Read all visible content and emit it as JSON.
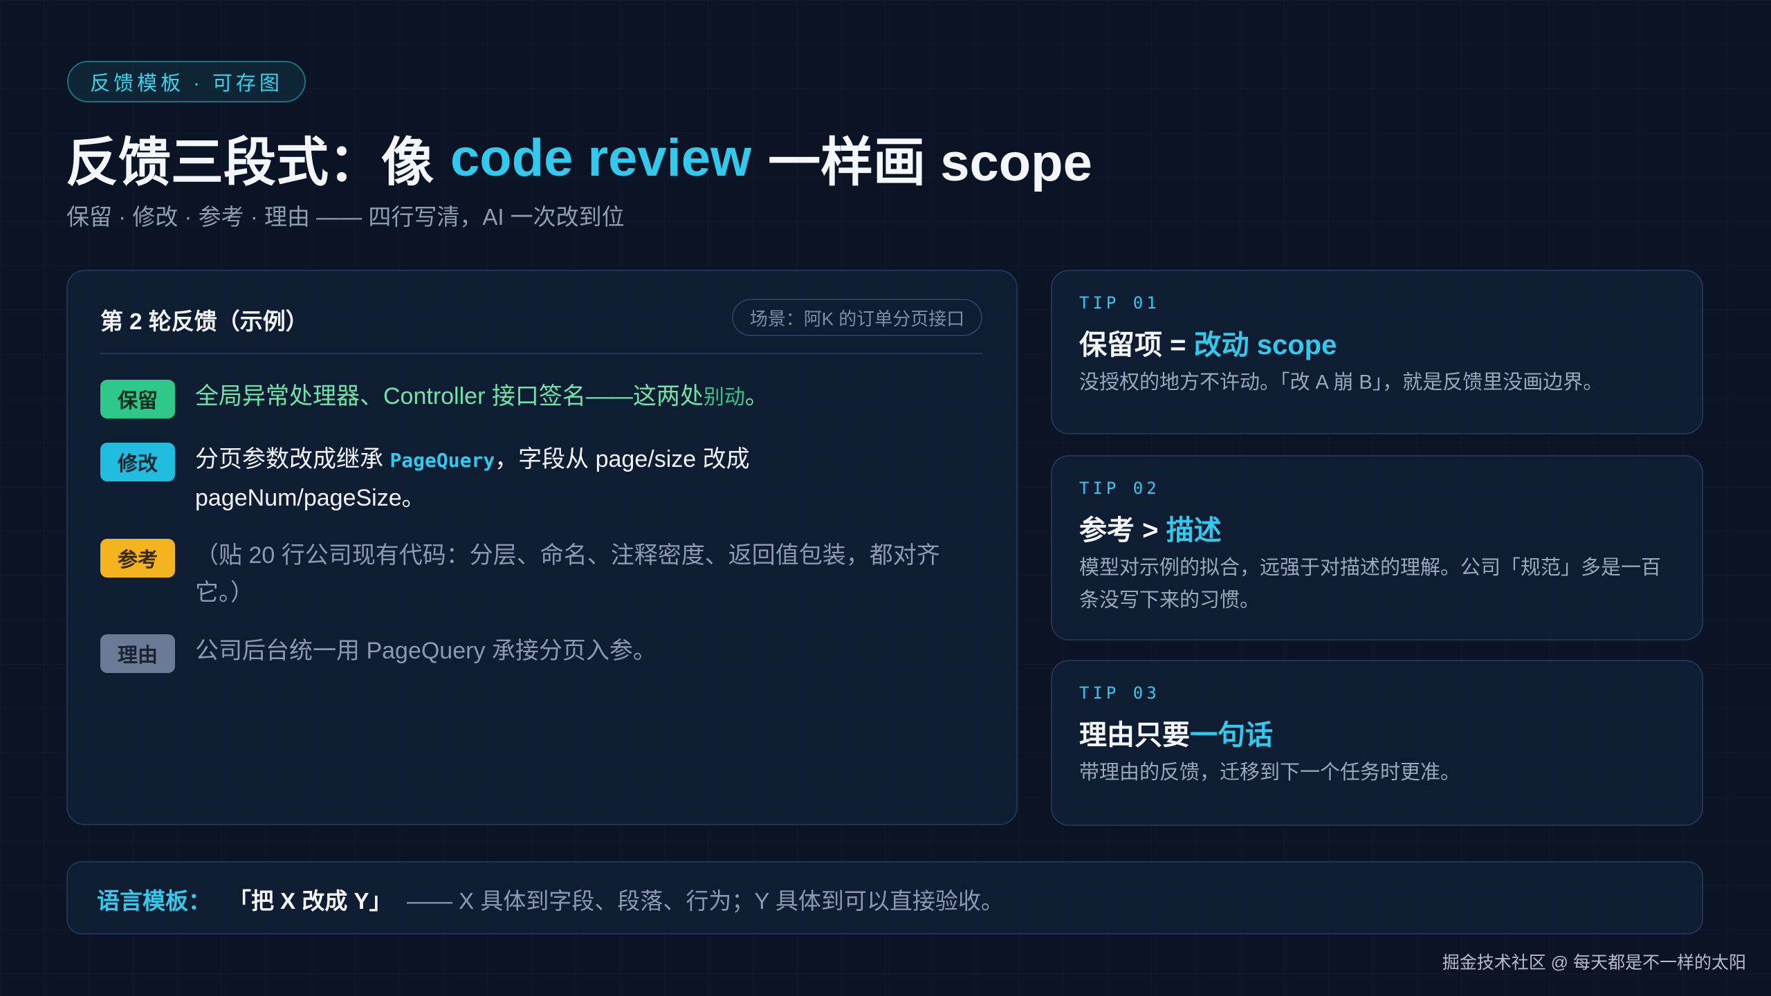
{
  "header": {
    "pill": "反馈模板 · 可存图",
    "title_pre": "反馈三段式：像",
    "title_accent": "code review",
    "title_post": "一样画 scope",
    "subtitle": "保留 · 修改 · 参考 · 理由 —— 四行写清，AI 一次改到位"
  },
  "example": {
    "title": "第 2 轮反馈（示例）",
    "scene": "场景：阿K 的订单分页接口",
    "rows": [
      {
        "tag": "保留",
        "text_pre": "全局异常处理器、Controller 接口签名——这两处",
        "text_highlight": "别动",
        "text_post": "。"
      },
      {
        "tag": "修改",
        "text_pre": "分页参数改成继承 ",
        "text_code": "PageQuery",
        "text_post": "，字段从 page/size 改成",
        "text_line2": "pageNum/pageSize。"
      },
      {
        "tag": "参考",
        "text_line1": "（贴 20 行公司现有代码：分层、命名、注释密度、返回值包装，都对齐",
        "text_line2": "它。）"
      },
      {
        "tag": "理由",
        "text": "公司后台统一用 PageQuery 承接分页入参。"
      }
    ]
  },
  "tips": [
    {
      "label": "TIP 01",
      "head_pre": "保留项 = ",
      "head_accent": "改动 scope",
      "body": "没授权的地方不许动。「改 A 崩 B」，就是反馈里没画边界。"
    },
    {
      "label": "TIP 02",
      "head_pre": "参考 > ",
      "head_accent": "描述",
      "body": "模型对示例的拟合，远强于对描述的理解。公司「规范」多是一百条没写下来的习惯。"
    },
    {
      "label": "TIP 03",
      "head_pre": "理由只要",
      "head_accent": "一句话",
      "body": "带理由的反馈，迁移到下一个任务时更准。"
    }
  ],
  "bottom": {
    "label": "语言模板：",
    "quote": "「把 X 改成 Y」",
    "desc": "—— X 具体到字段、段落、行为；Y 具体到可以直接验收。"
  },
  "footer": "掘金技术社区 @ 每天都是不一样的太阳",
  "colors": {
    "background": "#0b1425",
    "accent": "#33c9ec",
    "keep": "#2fc88a",
    "modify": "#20bde0",
    "reference": "#f4b41f",
    "reason": "#6b7a95"
  }
}
